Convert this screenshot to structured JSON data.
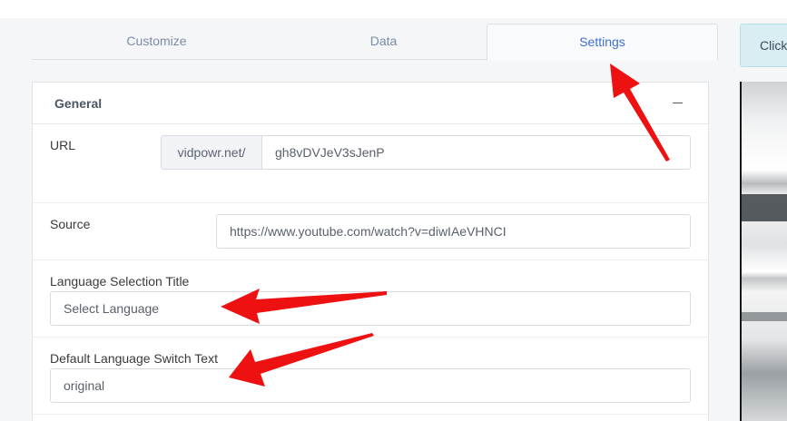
{
  "tabs": [
    {
      "label": "Customize"
    },
    {
      "label": "Data"
    },
    {
      "label": "Settings",
      "active": true
    }
  ],
  "preview_button": {
    "label": "Click"
  },
  "panel": {
    "title": "General",
    "collapse_icon": "minus-icon",
    "url": {
      "label": "URL",
      "prefix": "vidpowr.net/",
      "value": "gh8vDVJeV3sJenP"
    },
    "source": {
      "label": "Source",
      "value": "https://www.youtube.com/watch?v=diwIAeVHNCI"
    },
    "language_selection": {
      "label": "Language Selection Title",
      "value": "Select Language"
    },
    "default_switch": {
      "label": "Default Language Switch Text",
      "value": "original"
    }
  },
  "annotations": {
    "arrow_color": "#ee1111"
  },
  "colors": {
    "accent": "#3f6fd1",
    "tab_inactive": "#7b8ba3",
    "preview_button_bg": "#d9eef3"
  }
}
